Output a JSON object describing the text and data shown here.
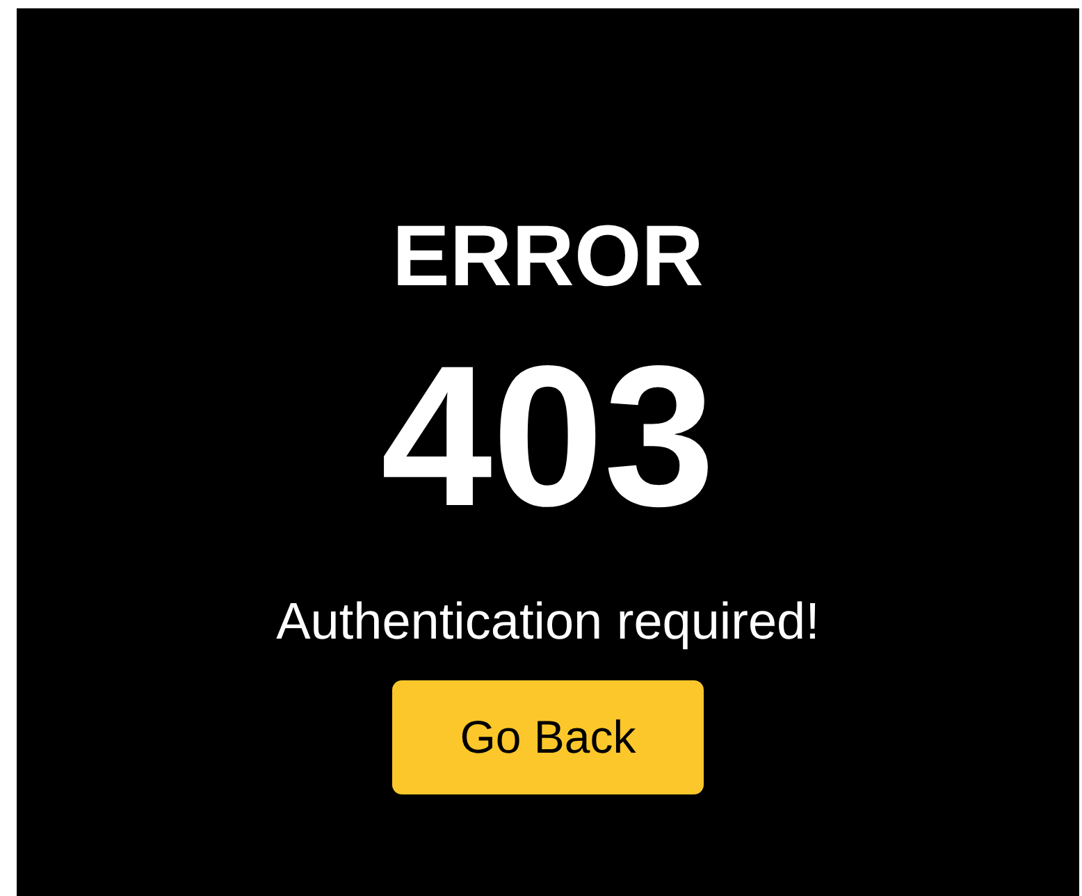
{
  "heading": "ERROR",
  "code": "403",
  "message": "Authentication required!",
  "button": {
    "label": "Go Back"
  }
}
